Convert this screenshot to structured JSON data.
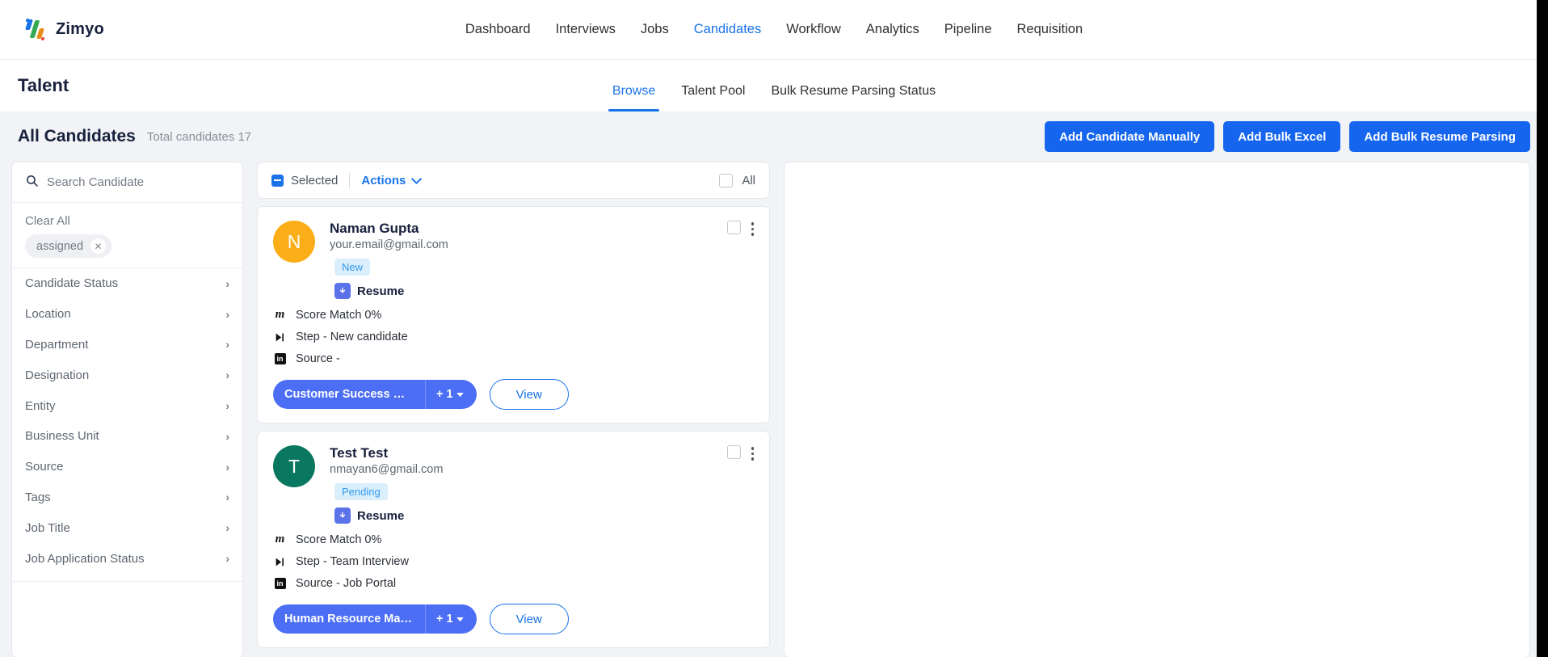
{
  "brand": {
    "name": "Zimyo",
    "logo_icon": "zimyo-logo-icon"
  },
  "mainnav": {
    "items": [
      {
        "label": "Dashboard",
        "active": false
      },
      {
        "label": "Interviews",
        "active": false
      },
      {
        "label": "Jobs",
        "active": false
      },
      {
        "label": "Candidates",
        "active": true
      },
      {
        "label": "Workflow",
        "active": false
      },
      {
        "label": "Analytics",
        "active": false
      },
      {
        "label": "Pipeline",
        "active": false
      },
      {
        "label": "Requisition",
        "active": false
      }
    ]
  },
  "subnav": {
    "page_title": "Talent",
    "items": [
      {
        "label": "Browse",
        "active": true
      },
      {
        "label": "Talent Pool",
        "active": false
      },
      {
        "label": "Bulk Resume Parsing Status",
        "active": false
      }
    ]
  },
  "candidates_header": {
    "title": "All Candidates",
    "total_text": "Total candidates 17",
    "buttons": [
      {
        "label": "Add Candidate Manually"
      },
      {
        "label": "Add Bulk Excel"
      },
      {
        "label": "Add Bulk Resume Parsing"
      }
    ]
  },
  "sidebar": {
    "search": {
      "placeholder": "Search Candidate",
      "value": "",
      "icon": "search-icon"
    },
    "clear_all": "Clear All",
    "chips": [
      {
        "label": "assigned",
        "remove_icon": "close-icon"
      }
    ],
    "filters": [
      {
        "label": "Candidate Status"
      },
      {
        "label": "Location"
      },
      {
        "label": "Department"
      },
      {
        "label": "Designation"
      },
      {
        "label": "Entity"
      },
      {
        "label": "Business Unit"
      },
      {
        "label": "Source"
      },
      {
        "label": "Tags"
      },
      {
        "label": "Job Title"
      },
      {
        "label": "Job Application Status"
      }
    ]
  },
  "toolbar": {
    "selected_label": "Selected",
    "actions_label": "Actions",
    "all_label": "All",
    "dropdown_icon": "chevron-down-icon"
  },
  "cards": [
    {
      "avatar_letter": "N",
      "avatar_color": "#FBAE17",
      "name": "Naman Gupta",
      "email": "your.email@gmail.com",
      "badge": "New",
      "resume_label": "Resume",
      "score_match": "Score Match 0%",
      "step": "Step - New candidate",
      "source": "Source -",
      "job_tag": "Customer Success Manag...",
      "job_more": "+ 1",
      "view_label": "View"
    },
    {
      "avatar_letter": "T",
      "avatar_color": "#0A7860",
      "name": "Test Test",
      "email": "nmayan6@gmail.com",
      "badge": "Pending",
      "resume_label": "Resume",
      "score_match": "Score Match 0%",
      "step": "Step - Team Interview",
      "source": "Source - Job Portal",
      "job_tag": "Human Resource Manage...",
      "job_more": "+ 1",
      "view_label": "View"
    }
  ],
  "colors": {
    "accent_blue": "#1a73e8",
    "button_blue": "#1565ef",
    "pill_blue": "#4c6ef5",
    "badge_bg": "#dbeefc",
    "badge_text": "#2e9bf0"
  }
}
